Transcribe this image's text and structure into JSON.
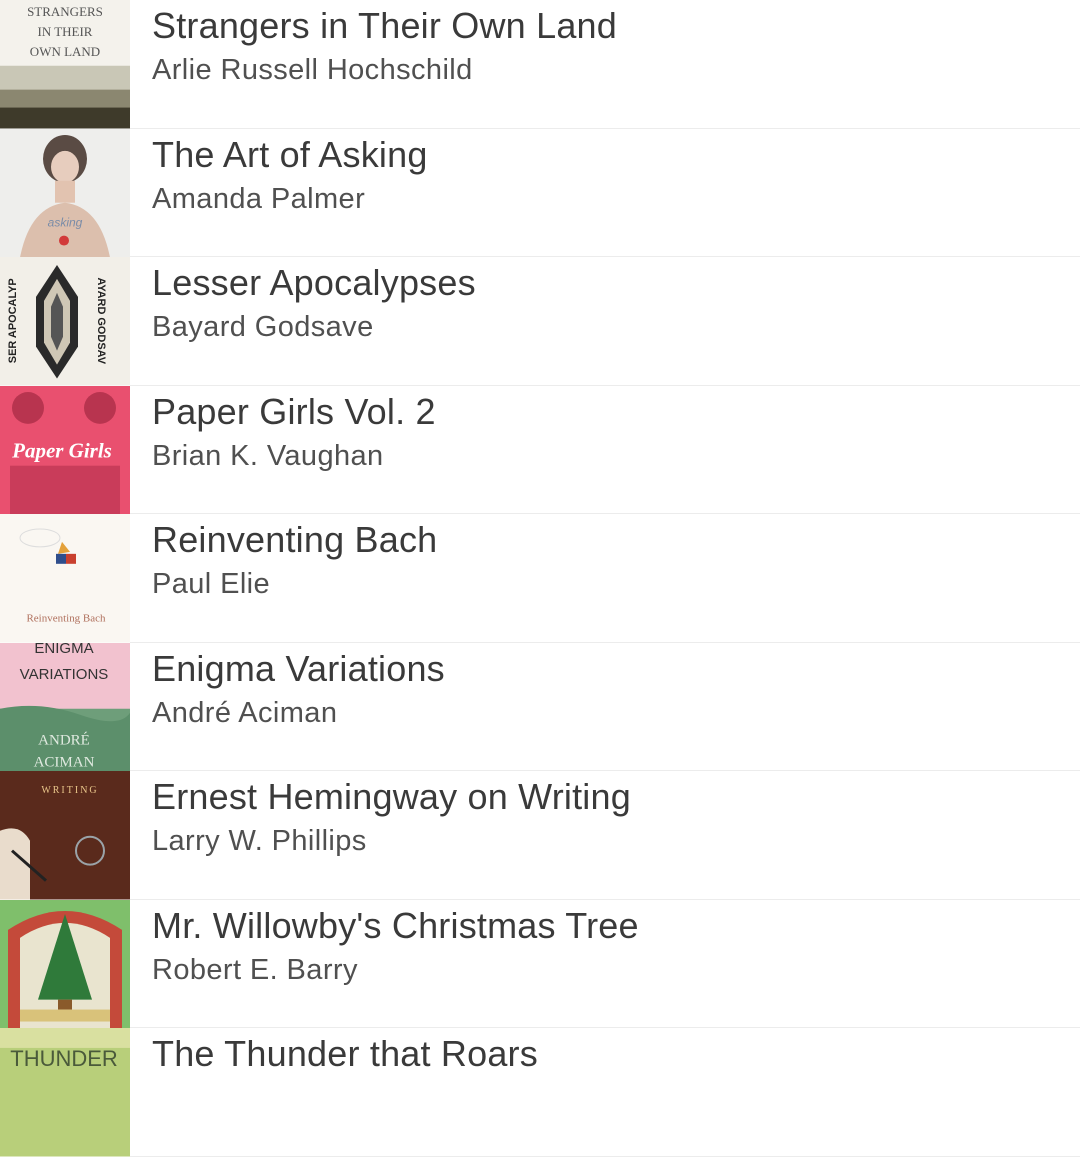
{
  "books": [
    {
      "title": "Strangers in Their Own Land",
      "author": "Arlie Russell Hochschild",
      "cover_icon": "book-cover",
      "cover_text": [
        "STRANGERS",
        "IN THEIR",
        "OWN LAND"
      ]
    },
    {
      "title": "The Art of Asking",
      "author": "Amanda Palmer",
      "cover_icon": "book-cover"
    },
    {
      "title": "Lesser Apocalypses",
      "author": "Bayard Godsave",
      "cover_icon": "book-cover",
      "cover_text": [
        "SER APOCALYP",
        "AYARD GODSAV"
      ]
    },
    {
      "title": "Paper Girls Vol. 2",
      "author": "Brian K. Vaughan",
      "cover_icon": "book-cover",
      "cover_text": [
        "Paper Girls"
      ]
    },
    {
      "title": "Reinventing Bach",
      "author": "Paul Elie",
      "cover_icon": "book-cover",
      "cover_text": [
        "Reinventing Bach"
      ]
    },
    {
      "title": "Enigma Variations",
      "author": "André Aciman",
      "cover_icon": "book-cover",
      "cover_text": [
        "ENIGMA",
        "VARIATIONS",
        "ANDRÉ",
        "ACIMAN"
      ]
    },
    {
      "title": "Ernest Hemingway on Writing",
      "author": "Larry W. Phillips",
      "cover_icon": "book-cover",
      "cover_text": [
        "WRITING"
      ]
    },
    {
      "title": "Mr. Willowby's Christmas Tree",
      "author": "Robert E. Barry",
      "cover_icon": "book-cover"
    },
    {
      "title": "The Thunder that Roars",
      "author": "",
      "cover_icon": "book-cover",
      "cover_text": [
        "THUNDER"
      ]
    }
  ],
  "colors": {
    "title_text": "#3a3a3a",
    "author_text": "#505050",
    "separator": "#ececec"
  }
}
